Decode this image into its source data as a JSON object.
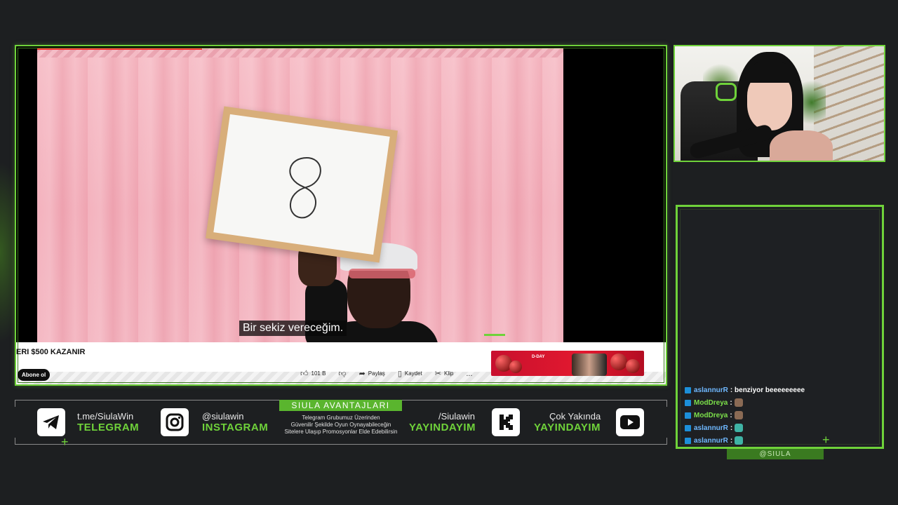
{
  "video": {
    "subtitle": "Bir sekiz vereceğim.",
    "title": "ERI $500 KAZANIR",
    "subscribe_label": "Abone ol",
    "actions": [
      {
        "icon": "thumbs-up-icon",
        "label": "101 B"
      },
      {
        "icon": "thumbs-down-icon",
        "label": ""
      },
      {
        "icon": "share-icon",
        "label": "Paylaş"
      },
      {
        "icon": "bookmark-icon",
        "label": "Kaydet"
      },
      {
        "icon": "scissors-icon",
        "label": "Klip"
      },
      {
        "icon": "more-icon",
        "label": "..."
      }
    ],
    "ad_text_line1": "D-DAY",
    "ad_text_line2": "",
    "ad_button": "",
    "board_drawing": "8"
  },
  "social": {
    "telegram_top": "t.me/SiulaWin",
    "telegram_bot": "TELEGRAM",
    "instagram_top": "@siulawin",
    "instagram_bot": "INSTAGRAM",
    "avantaj_title": "SIULA AVANTAJLARI",
    "avantaj_line1": "Telegram Grubumuz Üzerinden",
    "avantaj_line2": "Güvenilir Şekilde Oyun Oynayabileceğin",
    "avantaj_line3": "Sitelere Ulaşıp Promosyonlar Elde Edebilirsin",
    "kick_top": "/Siulawin",
    "kick_bot": "YAYINDAYIM",
    "youtube_top": "Çok Yakında",
    "youtube_bot": "YAYINDAYIM"
  },
  "chat": {
    "messages": [
      {
        "user": "aslannurR",
        "sep": ":",
        "text": "benziyor beeeeeeeee",
        "color": "#6fb8ff",
        "emote": ""
      },
      {
        "user": "ModDreya",
        "sep": ":",
        "text": "",
        "color": "#7ce04a",
        "emote": "cat-emote"
      },
      {
        "user": "ModDreya",
        "sep": ":",
        "text": "",
        "color": "#7ce04a",
        "emote": "cat-emote"
      },
      {
        "user": "aslannurR",
        "sep": ":",
        "text": "",
        "color": "#6fb8ff",
        "emote": "dance-emote"
      },
      {
        "user": "aslannurR",
        "sep": ":",
        "text": "",
        "color": "#6fb8ff",
        "emote": "dance-emote"
      }
    ]
  },
  "footer_tag": "@SIULA",
  "colors": {
    "accent_green": "#6fd23a",
    "background": "#1d1f21"
  }
}
